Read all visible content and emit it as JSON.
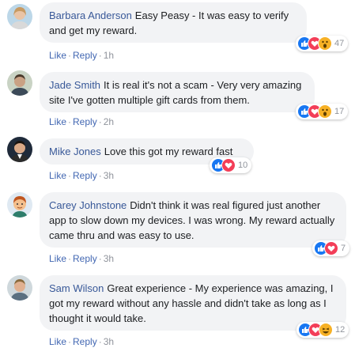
{
  "colors": {
    "link": "#4267b2",
    "author": "#385898",
    "bubble": "#f2f3f5",
    "meta": "#90949c"
  },
  "comments": [
    {
      "author": "Barbara Anderson",
      "text": "Easy Peasy - It was easy to verify and get my reward.",
      "actions": {
        "like": "Like",
        "reply": "Reply",
        "time": "1h"
      },
      "reactions": {
        "icons": [
          "like-icon",
          "love-icon",
          "wow-icon"
        ],
        "count": "47"
      }
    },
    {
      "author": "Jade Smith",
      "text": "It is real it's not a scam - Very very amazing site I've gotten multiple gift cards from them.",
      "actions": {
        "like": "Like",
        "reply": "Reply",
        "time": "2h"
      },
      "reactions": {
        "icons": [
          "like-icon",
          "love-icon",
          "wow-icon"
        ],
        "count": "17"
      }
    },
    {
      "author": "Mike Jones",
      "text": "Love this got my reward fast",
      "actions": {
        "like": "Like",
        "reply": "Reply",
        "time": "3h"
      },
      "reactions": {
        "icons": [
          "like-icon",
          "love-icon"
        ],
        "count": "10"
      }
    },
    {
      "author": "Carey Johnstone",
      "text": "Didn't think it was real figured just another app to slow down my devices. I was wrong. My reward actually came thru and was easy to use.",
      "actions": {
        "like": "Like",
        "reply": "Reply",
        "time": "3h"
      },
      "reactions": {
        "icons": [
          "like-icon",
          "love-icon"
        ],
        "count": "7"
      }
    },
    {
      "author": "Sam Wilson",
      "text": "Great experience - My experience was amazing, I got my reward without any hassle and didn't take as long as I thought it would take.",
      "actions": {
        "like": "Like",
        "reply": "Reply",
        "time": "3h"
      },
      "reactions": {
        "icons": [
          "like-icon",
          "love-icon",
          "haha-icon"
        ],
        "count": "12"
      }
    }
  ]
}
